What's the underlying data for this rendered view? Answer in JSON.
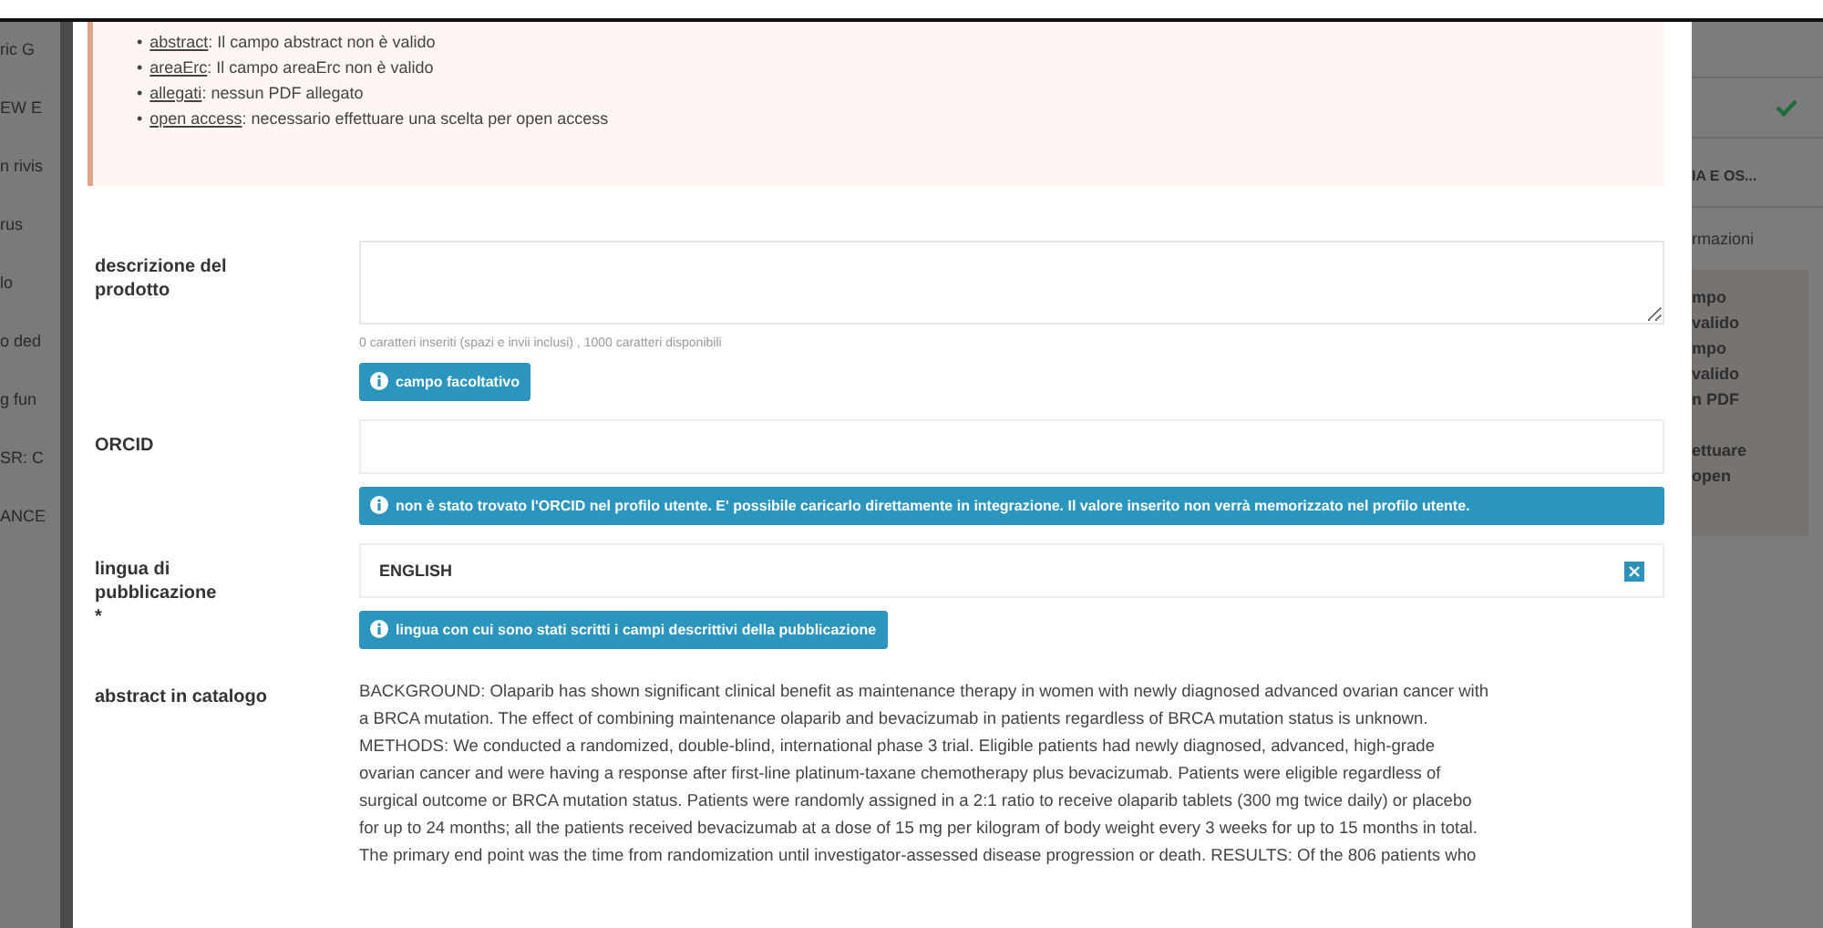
{
  "background_left": [
    "ric G",
    "EW E",
    "n rivis",
    "rus",
    "lo",
    "o ded",
    "g fun",
    "SR: C",
    "ANCE"
  ],
  "background_right": {
    "section": "IA E OS...",
    "tab": "rmazioni",
    "notes": [
      "mpo",
      "valido",
      "mpo",
      "valido",
      "n PDF"
    ],
    "notes_lower": [
      "ettuare",
      "open"
    ]
  },
  "errors": [
    {
      "bullet": "•",
      "field": "abstract",
      "message": ": Il campo abstract non è valido"
    },
    {
      "bullet": "•",
      "field": "areaErc",
      "message": ": Il campo areaErc non è valido"
    },
    {
      "bullet": "•",
      "field": "allegati",
      "message": ": nessun PDF allegato"
    },
    {
      "bullet": "•",
      "field": "open access",
      "message": ": necessario effettuare una scelta per open access"
    }
  ],
  "fields": [
    {
      "kind": "textarea",
      "label": "descrizione del prodotto",
      "counter": "0 caratteri inseriti (spazi e invii inclusi) , 1000 caratteri disponibili",
      "hint": "campo facoltativo"
    },
    {
      "kind": "input",
      "label": "ORCID",
      "hint": "non è stato trovato l'ORCID nel profilo utente. E' possibile caricarlo direttamente in integrazione. Il valore inserito non verrà memorizzato nel profilo utente."
    },
    {
      "kind": "select",
      "label": "lingua di pubblicazione",
      "required": "*",
      "value": "ENGLISH",
      "hint": "lingua con cui sono stati scritti i campi descrittivi della pubblicazione"
    },
    {
      "kind": "text",
      "label": "abstract in catalogo",
      "lines": [
        "BACKGROUND: Olaparib has shown significant clinical benefit as maintenance therapy in women with newly diagnosed advanced ovarian cancer with",
        "a BRCA mutation. The effect of combining maintenance olaparib and bevacizumab in patients regardless of BRCA mutation status is unknown.",
        "METHODS: We conducted a randomized, double-blind, international phase 3 trial. Eligible patients had newly diagnosed, advanced, high-grade",
        "ovarian cancer and were having a response after first-line platinum-taxane chemotherapy plus bevacizumab. Patients were eligible regardless of",
        "surgical outcome or BRCA mutation status. Patients were randomly assigned in a 2:1 ratio to receive olaparib tablets (300 mg twice daily) or placebo",
        "for up to 24 months; all the patients received bevacizumab at a dose of 15 mg per kilogram of body weight every 3 weeks for up to 15 months in total.",
        "The primary end point was the time from randomization until investigator-assessed disease progression or death. RESULTS: Of the 806 patients who"
      ]
    }
  ]
}
